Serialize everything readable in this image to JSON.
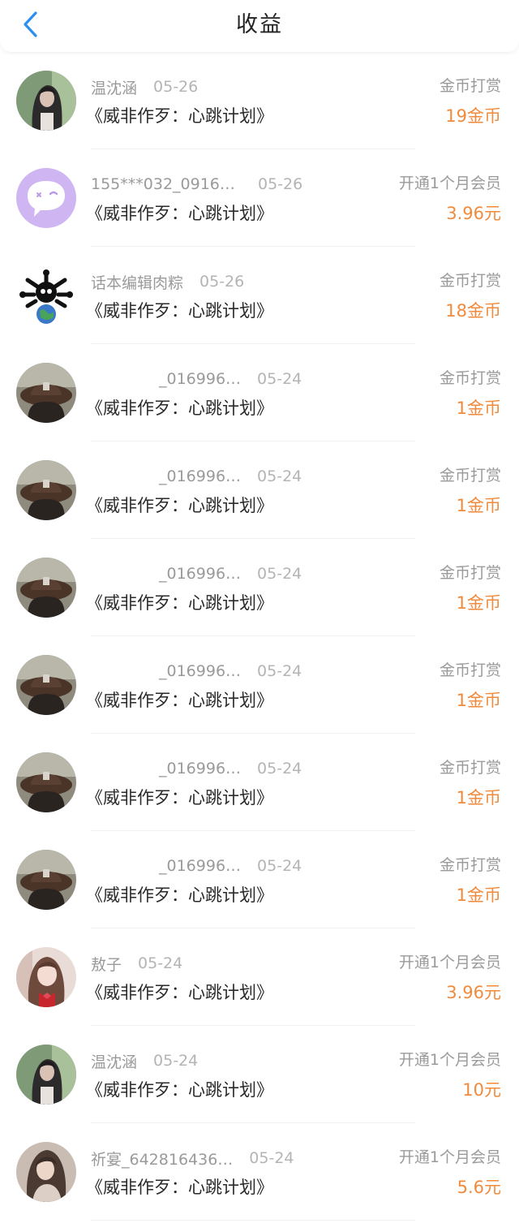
{
  "header": {
    "title": "收益",
    "back_icon": "chevron-left-icon",
    "accent_color": "#2b8ef0"
  },
  "colors": {
    "amount": "#f08a3c",
    "secondary_text": "#9a9a9a",
    "primary_text": "#2a2a2a"
  },
  "records": [
    {
      "user": "温沈涵",
      "date": "05-26",
      "book": "《威非作歹：心跳计划》",
      "type": "金币打赏",
      "amount": "19金币",
      "avatar": "girl-dark-hair-avatar"
    },
    {
      "user": "155***032_09166…",
      "date": "05-26",
      "book": "《威非作歹：心跳计划》",
      "type": "开通1个月会员",
      "amount": "3.96元",
      "avatar": "chat-bubble-avatar"
    },
    {
      "user": "话本编辑肉粽",
      "date": "05-26",
      "book": "《威非作歹：心跳计划》",
      "type": "金币打赏",
      "amount": "18金币",
      "avatar": "spiky-creature-globe-avatar"
    },
    {
      "user": "_016996…",
      "date": "05-24",
      "book": "《威非作歹：心跳计划》",
      "type": "金币打赏",
      "amount": "1金币",
      "avatar": "brown-hat-avatar"
    },
    {
      "user": "_016996…",
      "date": "05-24",
      "book": "《威非作歹：心跳计划》",
      "type": "金币打赏",
      "amount": "1金币",
      "avatar": "brown-hat-avatar"
    },
    {
      "user": "_016996…",
      "date": "05-24",
      "book": "《威非作歹：心跳计划》",
      "type": "金币打赏",
      "amount": "1金币",
      "avatar": "brown-hat-avatar"
    },
    {
      "user": "_016996…",
      "date": "05-24",
      "book": "《威非作歹：心跳计划》",
      "type": "金币打赏",
      "amount": "1金币",
      "avatar": "brown-hat-avatar"
    },
    {
      "user": "_016996…",
      "date": "05-24",
      "book": "《威非作歹：心跳计划》",
      "type": "金币打赏",
      "amount": "1金币",
      "avatar": "brown-hat-avatar"
    },
    {
      "user": "_016996…",
      "date": "05-24",
      "book": "《威非作歹：心跳计划》",
      "type": "金币打赏",
      "amount": "1金币",
      "avatar": "brown-hat-avatar"
    },
    {
      "user": "敖子",
      "date": "05-24",
      "book": "《威非作歹：心跳计划》",
      "type": "开通1个月会员",
      "amount": "3.96元",
      "avatar": "girl-pink-bow-avatar"
    },
    {
      "user": "温沈涵",
      "date": "05-24",
      "book": "《威非作歹：心跳计划》",
      "type": "开通1个月会员",
      "amount": "10元",
      "avatar": "girl-dark-hair-avatar"
    },
    {
      "user": "祈宴_642816436…",
      "date": "05-24",
      "book": "《威非作歹：心跳计划》",
      "type": "开通1个月会员",
      "amount": "5.6元",
      "avatar": "girl-long-hair-avatar"
    }
  ]
}
